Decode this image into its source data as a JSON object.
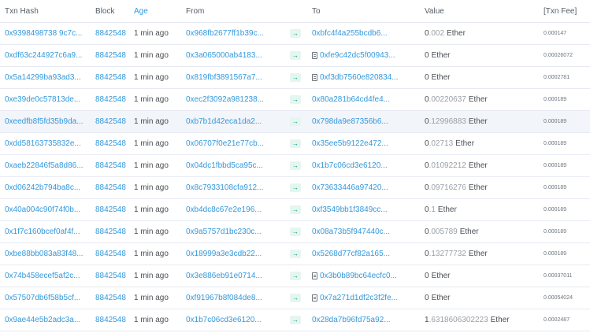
{
  "headers": {
    "txn_hash": "Txn Hash",
    "block": "Block",
    "age": "Age",
    "from": "From",
    "to": "To",
    "value": "Value",
    "txn_fee": "[Txn Fee]"
  },
  "colors": {
    "link": "#3498db",
    "arrow_bg": "#e6f5ef",
    "arrow_fg": "#00a186",
    "highlight_row": "#f2f5fa"
  },
  "icons": {
    "transfer": "arrow-right-icon",
    "contract": "file-text-icon"
  },
  "transactions": [
    {
      "hash": "0x9398498738 9c7c...",
      "block": "8842548",
      "age": "1 min ago",
      "from": "0x968fb2677ff1b39c...",
      "to": "0xbfc4f4a255bcdb6...",
      "to_contract": false,
      "value_int": "0",
      "value_dec": ".002",
      "unit": "Ether",
      "fee": "0.000147"
    },
    {
      "hash": "0xdf63c244927c6a9...",
      "block": "8842548",
      "age": "1 min ago",
      "from": "0x3a065000ab4183...",
      "to": "0xfe9c42dc5f00943...",
      "to_contract": true,
      "value_int": "0",
      "value_dec": "",
      "unit": "Ether",
      "fee": "0.00026072"
    },
    {
      "hash": "0x5a14299ba93ad3...",
      "block": "8842548",
      "age": "1 min ago",
      "from": "0x819fbf3891567a7...",
      "to": "0xf3db7560e820834...",
      "to_contract": true,
      "value_int": "0",
      "value_dec": "",
      "unit": "Ether",
      "fee": "0.0002781"
    },
    {
      "hash": "0xe39de0c57813de...",
      "block": "8842548",
      "age": "1 min ago",
      "from": "0xec2f3092a981238...",
      "to": "0x80a281b64cd4fe4...",
      "to_contract": false,
      "value_int": "0",
      "value_dec": ".00220637",
      "unit": "Ether",
      "fee": "0.000189"
    },
    {
      "hash": "0xeedfb8f5fd35b9da...",
      "block": "8842548",
      "age": "1 min ago",
      "from": "0xb7b1d42eca1da2...",
      "to": "0x798da9e87356b6...",
      "to_contract": false,
      "value_int": "0",
      "value_dec": ".12996883",
      "unit": "Ether",
      "fee": "0.000189"
    },
    {
      "hash": "0xdd58163735832e...",
      "block": "8842548",
      "age": "1 min ago",
      "from": "0x06707f0e21e77cb...",
      "to": "0x35ee5b9122e472...",
      "to_contract": false,
      "value_int": "0",
      "value_dec": ".02713",
      "unit": "Ether",
      "fee": "0.000189"
    },
    {
      "hash": "0xaeb22846f5a8d86...",
      "block": "8842548",
      "age": "1 min ago",
      "from": "0x04dc1fbbd5ca95c...",
      "to": "0x1b7c06cd3e6120...",
      "to_contract": false,
      "value_int": "0",
      "value_dec": ".01092212",
      "unit": "Ether",
      "fee": "0.000189"
    },
    {
      "hash": "0xd06242b794ba8c...",
      "block": "8842548",
      "age": "1 min ago",
      "from": "0x8c7933108cfa912...",
      "to": "0x73633446a97420...",
      "to_contract": false,
      "value_int": "0",
      "value_dec": ".09716276",
      "unit": "Ether",
      "fee": "0.000189"
    },
    {
      "hash": "0x40a004c90f74f0b...",
      "block": "8842548",
      "age": "1 min ago",
      "from": "0xb4dc8c67e2e196...",
      "to": "0xf3549bb1f3849cc...",
      "to_contract": false,
      "value_int": "0",
      "value_dec": ".1",
      "unit": "Ether",
      "fee": "0.000189"
    },
    {
      "hash": "0x1f7c160bcef0af4f...",
      "block": "8842548",
      "age": "1 min ago",
      "from": "0x9a5757d1bc230c...",
      "to": "0x08a73b5f947440c...",
      "to_contract": false,
      "value_int": "0",
      "value_dec": ".005789",
      "unit": "Ether",
      "fee": "0.000189"
    },
    {
      "hash": "0xbe88bb083a83f48...",
      "block": "8842548",
      "age": "1 min ago",
      "from": "0x18999a3e3cdb22...",
      "to": "0x5268d77cf82a165...",
      "to_contract": false,
      "value_int": "0",
      "value_dec": ".13277732",
      "unit": "Ether",
      "fee": "0.000189"
    },
    {
      "hash": "0x74b458ecef5af2c...",
      "block": "8842548",
      "age": "1 min ago",
      "from": "0x3e886eb91e0714...",
      "to": "0x3b0b89bc64ecfc0...",
      "to_contract": true,
      "value_int": "0",
      "value_dec": "",
      "unit": "Ether",
      "fee": "0.00037011"
    },
    {
      "hash": "0x57507db6f58b5cf...",
      "block": "8842548",
      "age": "1 min ago",
      "from": "0xf91967b8f084de8...",
      "to": "0x7a271d1df2c3f2fe...",
      "to_contract": true,
      "value_int": "0",
      "value_dec": "",
      "unit": "Ether",
      "fee": "0.00054024"
    },
    {
      "hash": "0x9ae44e5b2adc3a...",
      "block": "8842548",
      "age": "1 min ago",
      "from": "0x1b7c06cd3e6120...",
      "to": "0x28da7b96fd75a92...",
      "to_contract": false,
      "value_int": "1",
      "value_dec": ".6318606302223",
      "unit": "Ether",
      "fee": "0.0002487"
    }
  ]
}
